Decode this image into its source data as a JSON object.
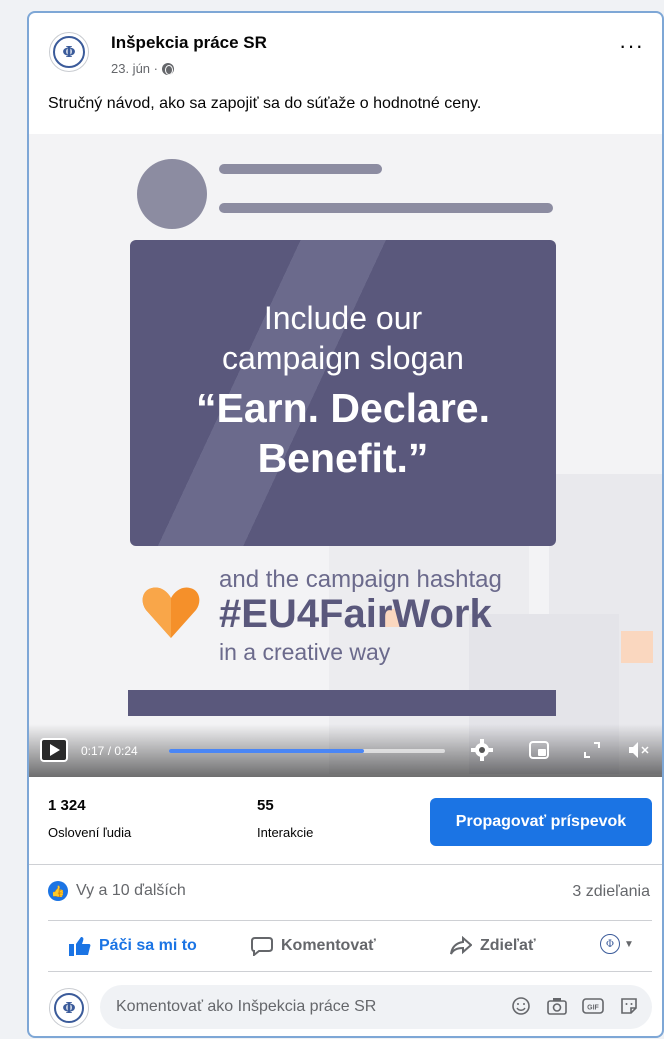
{
  "post": {
    "page_name": "Inšpekcia práce SR",
    "date": "23. jún ·",
    "text": "Stručný návod, ako sa zapojiť sa do súťaže o hodnotné ceny.",
    "avatar_symbol": "Φ"
  },
  "video": {
    "slogan_line1": "Include our",
    "slogan_line2": "campaign slogan",
    "slogan_line3": "“Earn. Declare.",
    "slogan_line4": "Benefit.”",
    "hashtag_intro": "and the campaign hashtag",
    "hashtag": "#EU4FairWork",
    "hashtag_outro": "in a creative way",
    "time": "0:17 / 0:24",
    "progress_fraction": 0.708
  },
  "insights": {
    "reach_value": "1 324",
    "reach_label": "Oslovení ľudia",
    "engagement_value": "55",
    "engagement_label": "Interakcie",
    "promote_label": "Propagovať príspevok"
  },
  "reactions": {
    "summary": "Vy a 10 ďalších",
    "shares": "3 zdieľania"
  },
  "actions": {
    "like": "Páči sa mi to",
    "comment": "Komentovať",
    "share": "Zdieľať"
  },
  "comment_input": {
    "placeholder": "Komentovať ako Inšpekcia práce SR"
  },
  "colors": {
    "accent": "#1b74e4",
    "slogan_bg": "#5a587c",
    "heart": "#f5902a"
  }
}
